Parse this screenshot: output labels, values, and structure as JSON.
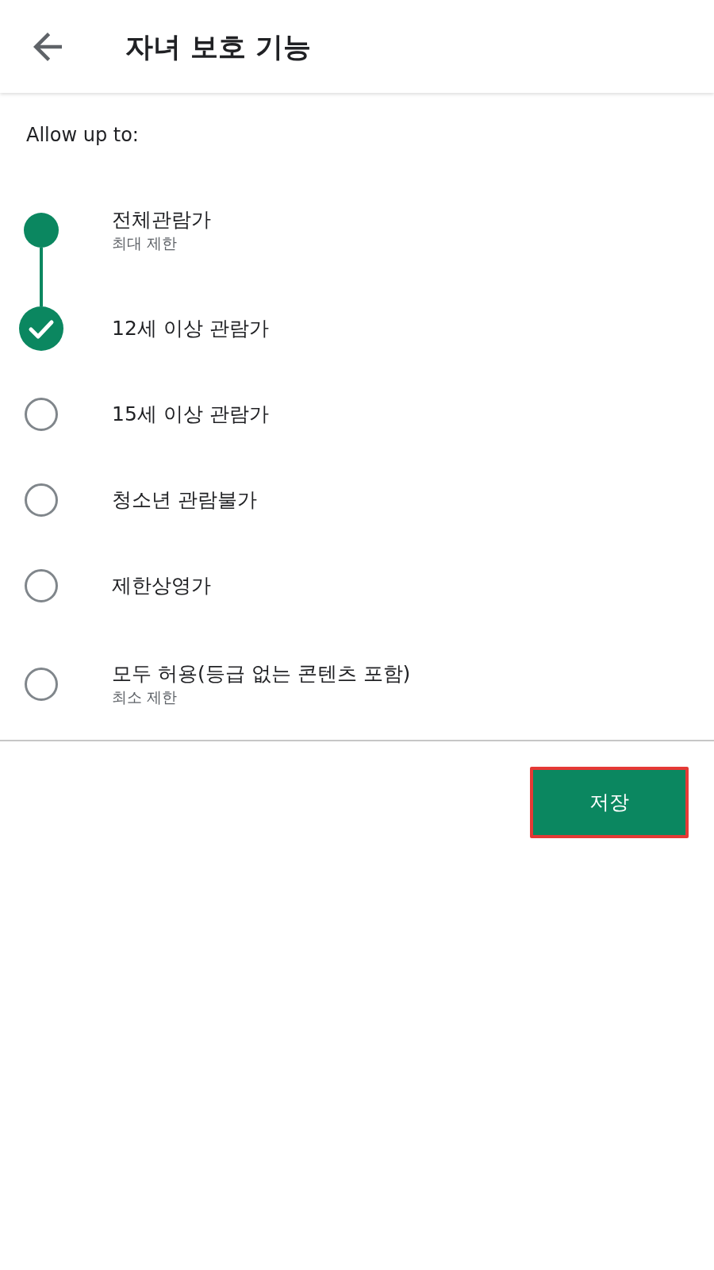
{
  "header": {
    "title": "자녀 보호 기능"
  },
  "prompt": "Allow up to:",
  "options": [
    {
      "label": "전체관람가",
      "subtitle": "최대 제한",
      "allowed": true,
      "selected": false
    },
    {
      "label": "12세 이상 관람가",
      "allowed": true,
      "selected": true
    },
    {
      "label": "15세 이상 관람가",
      "allowed": false,
      "selected": false
    },
    {
      "label": "청소년 관람불가",
      "allowed": false,
      "selected": false
    },
    {
      "label": "제한상영가",
      "allowed": false,
      "selected": false
    },
    {
      "label": "모두 허용(등급 없는 콘텐츠 포함)",
      "subtitle": "최소 제한",
      "allowed": false,
      "selected": false
    }
  ],
  "save_button": {
    "label": "저장",
    "highlighted": true
  }
}
